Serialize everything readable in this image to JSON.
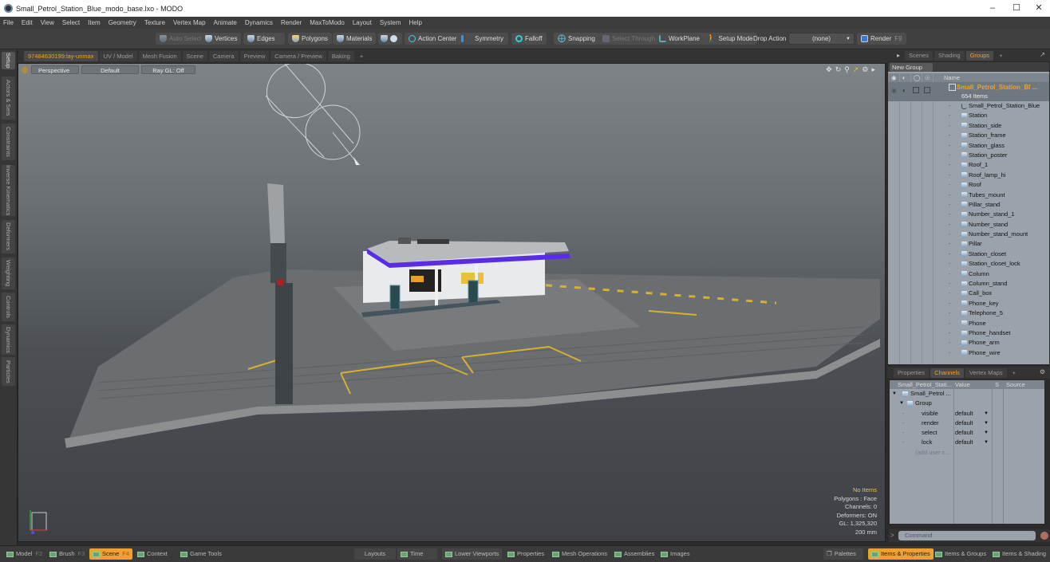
{
  "window": {
    "title": "Small_Petrol_Station_Blue_modo_base.lxo - MODO",
    "controls": [
      "minimize",
      "maximize",
      "close"
    ]
  },
  "menu": [
    "File",
    "Edit",
    "View",
    "Select",
    "Item",
    "Geometry",
    "Texture",
    "Vertex Map",
    "Animate",
    "Dynamics",
    "Render",
    "MaxToModo",
    "Layout",
    "System",
    "Help"
  ],
  "toolbar": {
    "auto_select": "Auto Select",
    "vertices": "Vertices",
    "edges": "Edges",
    "polygons": "Polygons",
    "materials": "Materials",
    "action_center": "Action Center",
    "symmetry": "Symmetry",
    "falloff": "Falloff",
    "snapping": "Snapping",
    "select_through": "Select Through",
    "workplane": "WorkPlane",
    "setup_mode": "Setup Mode",
    "drop_action_label": "Drop Action",
    "drop_action_value": "(none)",
    "render": "Render",
    "render_key": "F9"
  },
  "left_tabs": [
    "Setup",
    "Actors & Sets",
    "Constraints",
    "Inverse Kinematics",
    "Deformers",
    "Weighting",
    "Controls",
    "Dynamics",
    "Particles"
  ],
  "viewport_tabs": {
    "items": [
      "97484630199:lay-unmax",
      "UV / Model",
      "Mesh Fusion",
      "Scene",
      "Camera",
      "Preview",
      "Camera / Preview",
      "Baking"
    ],
    "active": 0,
    "add": "+"
  },
  "viewport": {
    "view_mode": "Perspective",
    "shading": "Default",
    "raygl": "Ray GL: Off",
    "stats": {
      "selection": "No Items",
      "polygons": "Polygons : Face",
      "channels": "Channels: 0",
      "deformers": "Deformers: ON",
      "gl": "GL: 1,325,320",
      "scale": "200 mm"
    }
  },
  "right_tabs": {
    "items": [
      "Scenes",
      "Shading",
      "Groups"
    ],
    "active": 2,
    "add": "+"
  },
  "groups": {
    "new_group": "New Group",
    "column_name": "Name",
    "group_name": "Small_Petrol_Station_Bl ...",
    "group_count": "654 Items",
    "items": [
      "Small_Petrol_Station_Blue",
      "Station",
      "Station_side",
      "Station_frame",
      "Station_glass",
      "Station_poster",
      "Roof_1",
      "Roof_lamp_hi",
      "Roof",
      "Tubes_mount",
      "Pillar_stand",
      "Number_stand_1",
      "Number_stand",
      "Number_stand_mount",
      "Pillar",
      "Station_closet",
      "Station_closet_lock",
      "Column",
      "Column_stand",
      "Call_box",
      "Phone_key",
      "Telephone_5",
      "Phone",
      "Phone_handset",
      "Phone_arm",
      "Phone_wire"
    ]
  },
  "channels_tabs": {
    "items": [
      "Properties",
      "Channels",
      "Vertex Maps"
    ],
    "active": 1,
    "add": "+"
  },
  "channels": {
    "headers": [
      "Small_Petrol_Stati...",
      "Value",
      "S",
      "Source"
    ],
    "root": "Small_Petrol ...",
    "group": "Group",
    "rows": [
      {
        "name": "visible",
        "value": "default"
      },
      {
        "name": "render",
        "value": "default"
      },
      {
        "name": "select",
        "value": "default"
      },
      {
        "name": "lock",
        "value": "default"
      }
    ],
    "add_user": "(add user c..."
  },
  "command": {
    "prompt": ">",
    "placeholder": "Command"
  },
  "bottom_bar": {
    "left": [
      {
        "label": "Model",
        "key": "F2"
      },
      {
        "label": "Brush",
        "key": "F3"
      },
      {
        "label": "Scene",
        "key": "F4",
        "active": true
      },
      {
        "label": "Context",
        "key": ""
      },
      {
        "label": "Game Tools",
        "key": ""
      }
    ],
    "center": [
      "Layouts",
      "Time",
      "Lower Viewports",
      "Properties",
      "Mesh Operations",
      "Assemblies",
      "Images"
    ],
    "right": [
      {
        "label": "Palettes"
      },
      {
        "label": "Items & Properties",
        "active": true
      },
      {
        "label": "Items & Groups"
      },
      {
        "label": "Items & Shading"
      }
    ]
  },
  "colors": {
    "accent": "#f0a030",
    "canopy_blue": "#5a2ee0",
    "panel_bg": "#9aa3ab"
  }
}
